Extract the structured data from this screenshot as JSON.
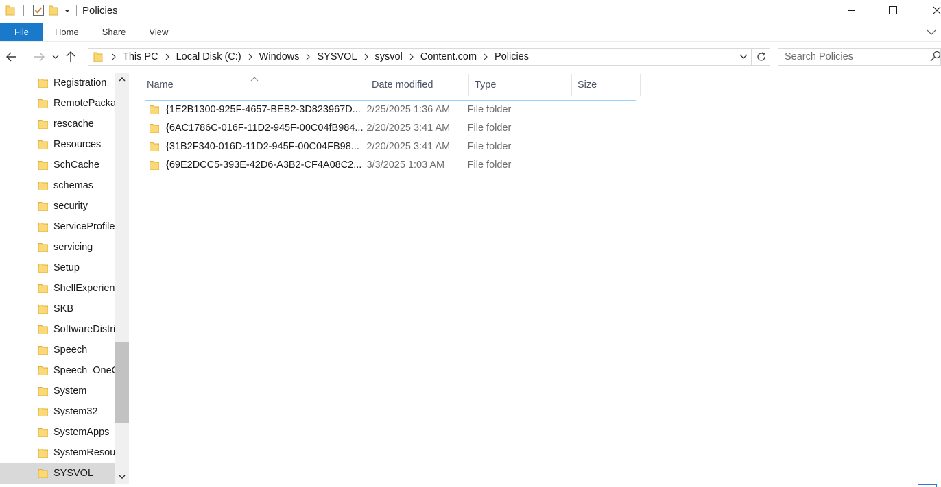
{
  "window": {
    "title": "Policies"
  },
  "ribbon": {
    "tabs": [
      {
        "label": "File"
      },
      {
        "label": "Home"
      },
      {
        "label": "Share"
      },
      {
        "label": "View"
      }
    ]
  },
  "address": {
    "crumbs": [
      "This PC",
      "Local Disk (C:)",
      "Windows",
      "SYSVOL",
      "sysvol",
      "Content.com",
      "Policies"
    ]
  },
  "search": {
    "placeholder": "Search Policies"
  },
  "nav": {
    "items": [
      {
        "label": "Registration"
      },
      {
        "label": "RemotePackages"
      },
      {
        "label": "rescache"
      },
      {
        "label": "Resources"
      },
      {
        "label": "SchCache"
      },
      {
        "label": "schemas"
      },
      {
        "label": "security"
      },
      {
        "label": "ServiceProfiles"
      },
      {
        "label": "servicing"
      },
      {
        "label": "Setup"
      },
      {
        "label": "ShellExperiences"
      },
      {
        "label": "SKB"
      },
      {
        "label": "SoftwareDistribution"
      },
      {
        "label": "Speech"
      },
      {
        "label": "Speech_OneCore"
      },
      {
        "label": "System"
      },
      {
        "label": "System32"
      },
      {
        "label": "SystemApps"
      },
      {
        "label": "SystemResources"
      },
      {
        "label": "SYSVOL"
      }
    ],
    "selected": "SYSVOL"
  },
  "columns": {
    "name": "Name",
    "date": "Date modified",
    "type": "Type",
    "size": "Size"
  },
  "files": [
    {
      "name": "{1E2B1300-925F-4657-BEB2-3D823967D...",
      "date": "2/25/2025 1:36 AM",
      "type": "File folder",
      "size": ""
    },
    {
      "name": "{6AC1786C-016F-11D2-945F-00C04fB984...",
      "date": "2/20/2025 3:41 AM",
      "type": "File folder",
      "size": ""
    },
    {
      "name": "{31B2F340-016D-11D2-945F-00C04FB98...",
      "date": "2/20/2025 3:41 AM",
      "type": "File folder",
      "size": ""
    },
    {
      "name": "{69E2DCC5-393E-42D6-A3B2-CF4A08C2...",
      "date": "3/3/2025 1:03 AM",
      "type": "File folder",
      "size": ""
    }
  ],
  "colors": {
    "accent": "#1979ca",
    "folder": "#f8d775",
    "folder_dark": "#e0b13e",
    "selection": "#d9d9d9",
    "focus_border": "#99d1ff"
  }
}
